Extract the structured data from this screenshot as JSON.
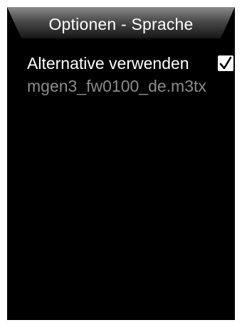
{
  "header": {
    "title": "Optionen - Sprache"
  },
  "options": {
    "alternative_label": "Alternative verwenden",
    "alternative_checked": true,
    "file_name": "mgen3_fw0100_de.m3tx"
  },
  "colors": {
    "background": "#000000",
    "header_gradient_top": "#7a7a7a",
    "header_gradient_bottom": "#1a1a1a",
    "active_text": "#ffffff",
    "inactive_text": "#8c8c8c"
  },
  "icons": {
    "checkbox": "checkmark-icon"
  }
}
